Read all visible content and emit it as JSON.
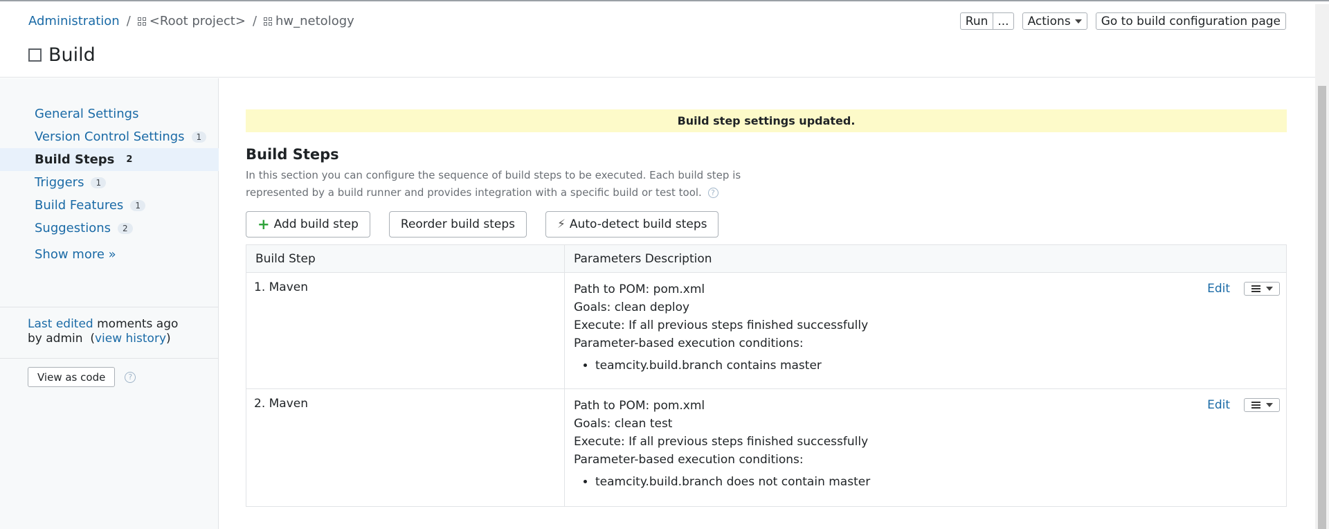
{
  "breadcrumb": {
    "admin": "Administration",
    "root": "<Root project>",
    "project": "hw_netology",
    "sep": "/"
  },
  "page_title": "Build",
  "header_buttons": {
    "run": "Run",
    "more": "...",
    "actions": "Actions",
    "goto": "Go to build configuration page"
  },
  "sidebar": {
    "items": [
      {
        "label": "General Settings",
        "count": ""
      },
      {
        "label": "Version Control Settings",
        "count": "1"
      },
      {
        "label": "Build Steps",
        "count": "2"
      },
      {
        "label": "Triggers",
        "count": "1"
      },
      {
        "label": "Build Features",
        "count": "1"
      },
      {
        "label": "Suggestions",
        "count": "2"
      }
    ],
    "show_more": "Show more »",
    "last_edited_link": "Last edited",
    "last_edited_time": "moments ago",
    "last_edited_by": "by admin",
    "view_history_open": "(",
    "view_history": "view history",
    "view_history_close": ")",
    "view_as_code": "View as code",
    "help": "?"
  },
  "main": {
    "flash": "Build step settings updated.",
    "section_title": "Build Steps",
    "description": "In this section you can configure the sequence of build steps to be executed. Each build step is represented by a build runner and provides integration with a specific build or test tool.",
    "help": "?",
    "add_step": "Add build step",
    "reorder": "Reorder build steps",
    "autodetect": "Auto-detect build steps",
    "columns": [
      "Build Step",
      "Parameters Description"
    ],
    "edit_label": "Edit",
    "steps": [
      {
        "name": "1. Maven",
        "pom": "Path to POM: pom.xml",
        "goals": "Goals: clean deploy",
        "execute": "Execute: If all previous steps finished successfully",
        "conditions_title": "Parameter-based execution conditions:",
        "condition": "teamcity.build.branch contains master"
      },
      {
        "name": "2. Maven",
        "pom": "Path to POM: pom.xml",
        "goals": "Goals: clean test",
        "execute": "Execute: If all previous steps finished successfully",
        "conditions_title": "Parameter-based execution conditions:",
        "condition": "teamcity.build.branch does not contain master"
      }
    ]
  },
  "colors": {
    "link": "#1a6aa6",
    "flash_bg": "#fdfac9",
    "sidebar_bg": "#f7f9fa",
    "active_bg": "#e8f1fb",
    "add_icon": "#2fa33b"
  }
}
